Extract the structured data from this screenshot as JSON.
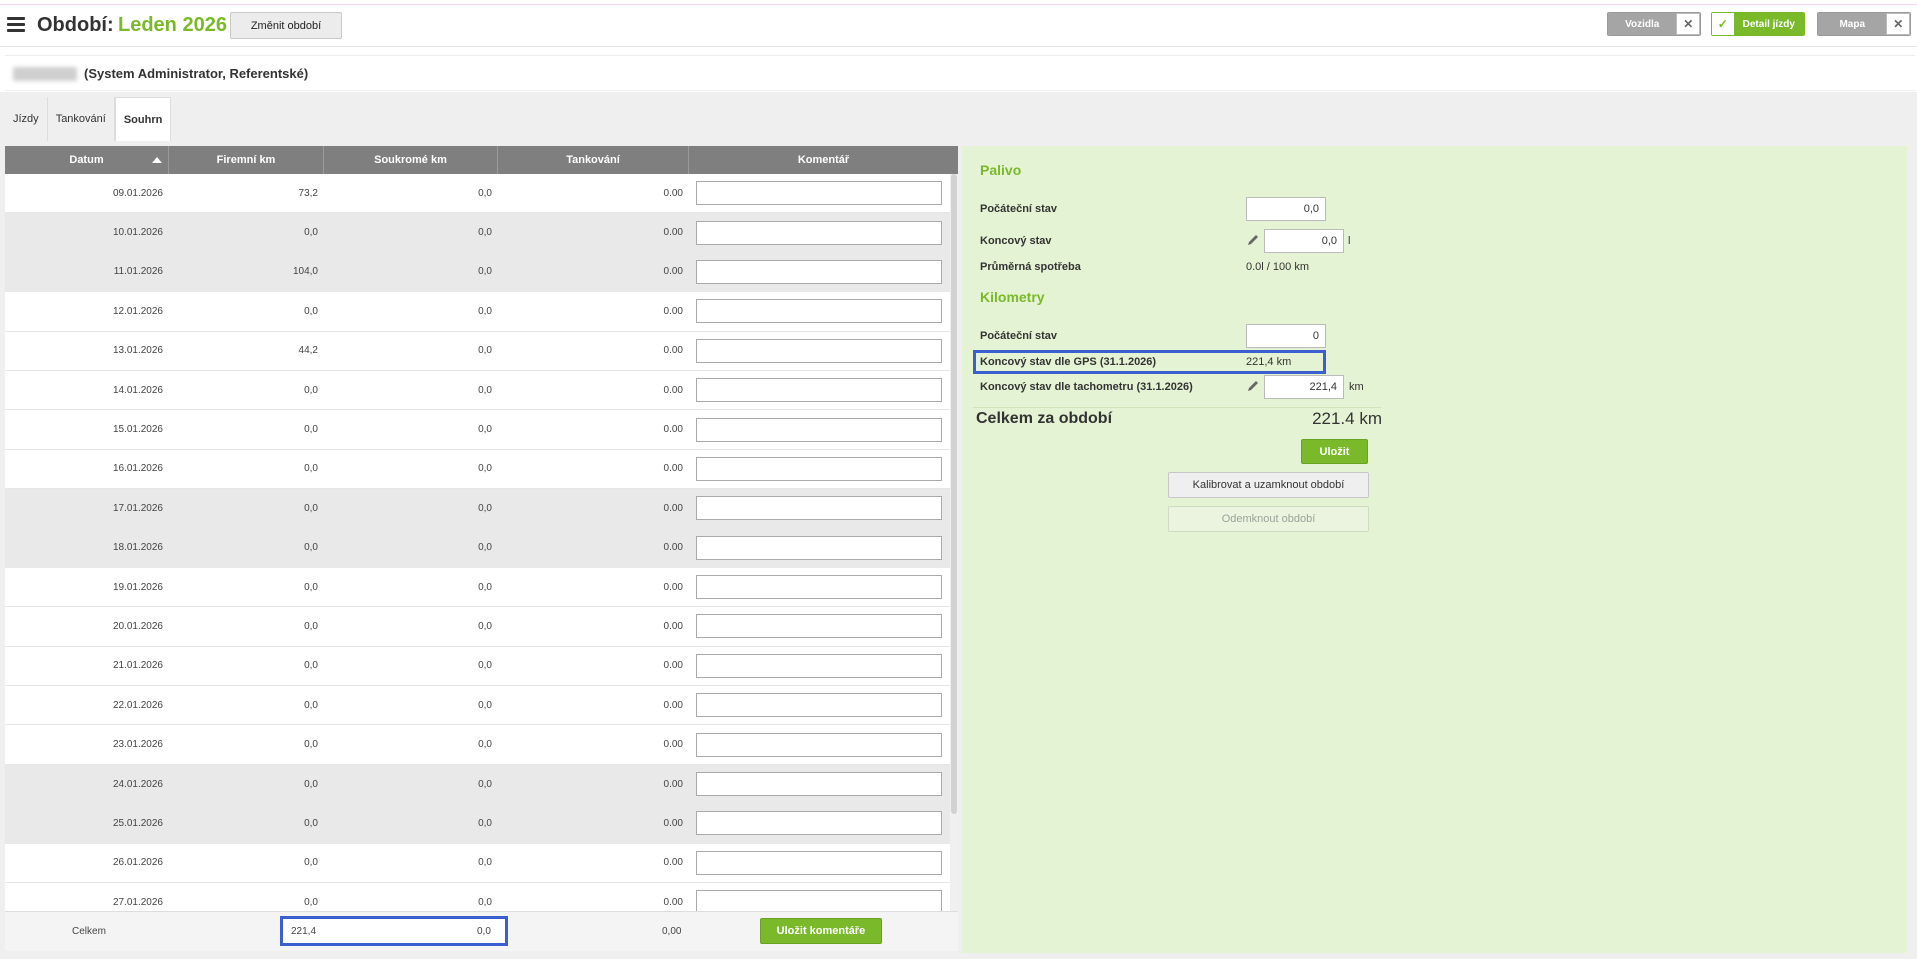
{
  "header": {
    "period_label": "Období:",
    "period_value": "Leden 2026",
    "change_period_button": "Změnit období",
    "vozidla_button": "Vozidla",
    "detail_button": "Detail jízdy",
    "mapa_button": "Mapa",
    "close_glyph": "✕",
    "check_glyph": "✓"
  },
  "user": {
    "text": "(System Administrator, Referentské)"
  },
  "tabs": [
    {
      "label": "Jízdy"
    },
    {
      "label": "Tankování"
    },
    {
      "label": "Souhrn"
    }
  ],
  "table": {
    "columns": [
      "Datum",
      "Firemní km",
      "Soukromé km",
      "Tankování",
      "Komentář"
    ],
    "rows": [
      {
        "date": "09.01.2026",
        "company": "73,2",
        "private": "0,0",
        "fuel": "0.00",
        "shaded": false
      },
      {
        "date": "10.01.2026",
        "company": "0,0",
        "private": "0,0",
        "fuel": "0.00",
        "shaded": true
      },
      {
        "date": "11.01.2026",
        "company": "104,0",
        "private": "0,0",
        "fuel": "0.00",
        "shaded": true
      },
      {
        "date": "12.01.2026",
        "company": "0,0",
        "private": "0,0",
        "fuel": "0.00",
        "shaded": false
      },
      {
        "date": "13.01.2026",
        "company": "44,2",
        "private": "0,0",
        "fuel": "0.00",
        "shaded": false
      },
      {
        "date": "14.01.2026",
        "company": "0,0",
        "private": "0,0",
        "fuel": "0.00",
        "shaded": false
      },
      {
        "date": "15.01.2026",
        "company": "0,0",
        "private": "0,0",
        "fuel": "0.00",
        "shaded": false
      },
      {
        "date": "16.01.2026",
        "company": "0,0",
        "private": "0,0",
        "fuel": "0.00",
        "shaded": false
      },
      {
        "date": "17.01.2026",
        "company": "0,0",
        "private": "0,0",
        "fuel": "0.00",
        "shaded": true
      },
      {
        "date": "18.01.2026",
        "company": "0,0",
        "private": "0,0",
        "fuel": "0.00",
        "shaded": true
      },
      {
        "date": "19.01.2026",
        "company": "0,0",
        "private": "0,0",
        "fuel": "0.00",
        "shaded": false
      },
      {
        "date": "20.01.2026",
        "company": "0,0",
        "private": "0,0",
        "fuel": "0.00",
        "shaded": false
      },
      {
        "date": "21.01.2026",
        "company": "0,0",
        "private": "0,0",
        "fuel": "0.00",
        "shaded": false
      },
      {
        "date": "22.01.2026",
        "company": "0,0",
        "private": "0,0",
        "fuel": "0.00",
        "shaded": false
      },
      {
        "date": "23.01.2026",
        "company": "0,0",
        "private": "0,0",
        "fuel": "0.00",
        "shaded": false
      },
      {
        "date": "24.01.2026",
        "company": "0,0",
        "private": "0,0",
        "fuel": "0.00",
        "shaded": true
      },
      {
        "date": "25.01.2026",
        "company": "0,0",
        "private": "0,0",
        "fuel": "0.00",
        "shaded": true
      },
      {
        "date": "26.01.2026",
        "company": "0,0",
        "private": "0,0",
        "fuel": "0.00",
        "shaded": false
      },
      {
        "date": "27.01.2026",
        "company": "0,0",
        "private": "0,0",
        "fuel": "0.00",
        "shaded": false
      }
    ],
    "footer": {
      "label": "Celkem",
      "company_total": "221,4",
      "private_total": "0,0",
      "fuel_total": "0,00",
      "save_comments_button": "Uložit komentáře"
    }
  },
  "summary": {
    "fuel_title": "Palivo",
    "fuel_start_label": "Počáteční stav",
    "fuel_start_value": "0,0",
    "fuel_end_label": "Koncový stav",
    "fuel_end_value": "0,0",
    "fuel_end_unit": "l",
    "avg_consumption_label": "Průměrná spotřeba",
    "avg_consumption_value": "0.0l / 100 km",
    "km_title": "Kilometry",
    "km_start_label": "Počáteční stav",
    "km_start_value": "0",
    "km_gps_label": "Koncový stav dle GPS (31.1.2026)",
    "km_gps_value": "221,4 km",
    "km_tacho_label": "Koncový stav dle tachometru (31.1.2026)",
    "km_tacho_value": "221,4",
    "km_tacho_unit": "km",
    "total_label": "Celkem za období",
    "total_value": "221.4 km",
    "save_button": "Uložit",
    "calibrate_button": "Kalibrovat a uzamknout období",
    "unlock_button": "Odemknout období"
  }
}
